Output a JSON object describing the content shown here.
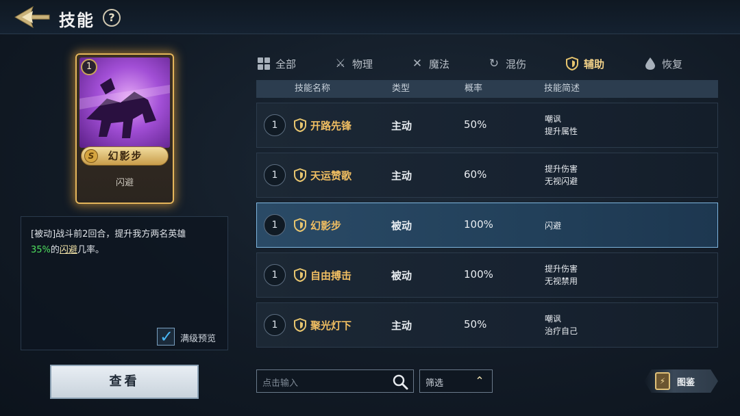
{
  "header": {
    "title": "技能",
    "help_label": "?"
  },
  "card": {
    "level": "1",
    "rarity": "S",
    "name": "幻影步",
    "type": "闪避"
  },
  "description": {
    "text_part1": "[被动]战斗前2回合，提升我方两名英雄",
    "value": "35%",
    "text_part2": "的",
    "keyword": "闪避",
    "text_part3": "几率。",
    "max_preview_label": "满级预览",
    "max_preview_checked": true
  },
  "view_button": "查看",
  "tabs": [
    {
      "label": "全部",
      "icon": "grid-icon",
      "active": false
    },
    {
      "label": "物理",
      "icon": "sword-icon",
      "active": false
    },
    {
      "label": "魔法",
      "icon": "magic-icon",
      "active": false
    },
    {
      "label": "混伤",
      "icon": "swirl-icon",
      "active": false
    },
    {
      "label": "辅助",
      "icon": "shield-icon",
      "active": true
    },
    {
      "label": "恢复",
      "icon": "droplet-icon",
      "active": false
    }
  ],
  "table_headers": {
    "name": "技能名称",
    "type": "类型",
    "prob": "概率",
    "desc": "技能简述"
  },
  "skills": [
    {
      "level": "1",
      "name": "开路先锋",
      "type": "主动",
      "prob": "50%",
      "desc1": "嘲讽",
      "desc2": "提升属性"
    },
    {
      "level": "1",
      "name": "天运赞歌",
      "type": "主动",
      "prob": "60%",
      "desc1": "提升伤害",
      "desc2": "无视闪避"
    },
    {
      "level": "1",
      "name": "幻影步",
      "type": "被动",
      "prob": "100%",
      "desc1": "闪避",
      "desc2": ""
    },
    {
      "level": "1",
      "name": "自由搏击",
      "type": "被动",
      "prob": "100%",
      "desc1": "提升伤害",
      "desc2": "无视禁用"
    },
    {
      "level": "1",
      "name": "聚光灯下",
      "type": "主动",
      "prob": "50%",
      "desc1": "嘲讽",
      "desc2": "治疗自己"
    }
  ],
  "search": {
    "placeholder": "点击输入"
  },
  "filter": {
    "label": "筛选"
  },
  "gallery": {
    "label": "图鉴"
  },
  "colors": {
    "accent_gold": "#f0be62",
    "highlight_green": "#4fe05e",
    "selected_border": "#7fb6df"
  }
}
